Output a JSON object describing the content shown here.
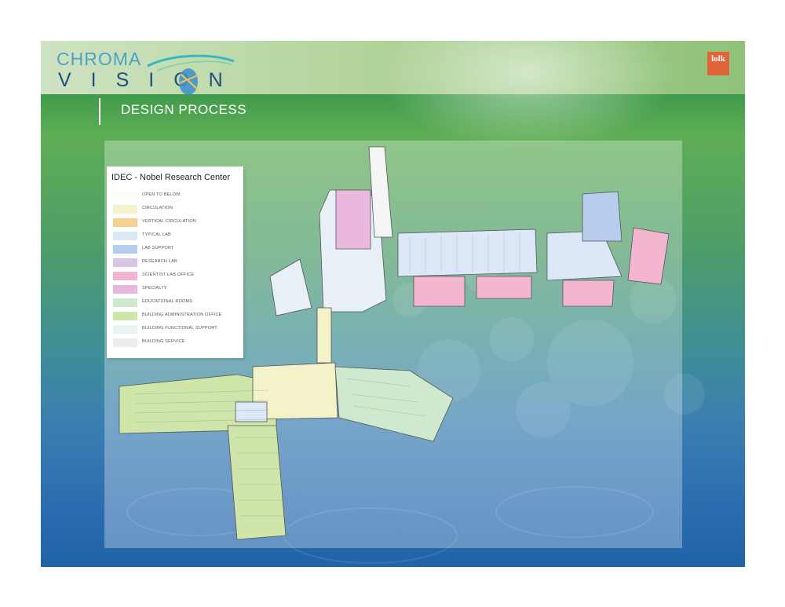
{
  "brand": {
    "name_line1": "CHROMA",
    "name_line2": "VISION",
    "badge_text": "lolk"
  },
  "section": {
    "title": "DESIGN PROCESS"
  },
  "legend": {
    "title": "IDEC - Nobel Research Center",
    "items": [
      {
        "label": "OPEN TO BELOW",
        "color": "#fdfdf5"
      },
      {
        "label": "CIRCULATION",
        "color": "#f4f2c8"
      },
      {
        "label": "VERTICAL CIRCULATION",
        "color": "#f7cf8f"
      },
      {
        "label": "TYPICAL LAB",
        "color": "#dce8f7"
      },
      {
        "label": "LAB SUPPORT",
        "color": "#b7cdee"
      },
      {
        "label": "RESEARCH LAB",
        "color": "#d8c5e6"
      },
      {
        "label": "SCIENTIST LAB OFFICE",
        "color": "#f3b5d0"
      },
      {
        "label": "SPECIALTY",
        "color": "#eab8de"
      },
      {
        "label": "EDUCATIONAL ROOMS",
        "color": "#cfe9cf"
      },
      {
        "label": "BUILDING ADMINISTRATION OFFICE",
        "color": "#cfe5a9"
      },
      {
        "label": "BUILDING FUNCTIONAL SUPPORT",
        "color": "#e7f4f3"
      },
      {
        "label": "BUILDING SERVICE",
        "color": "#ececec"
      }
    ]
  },
  "colors": {
    "accent_orange": "#e0633a",
    "vision_blue": "#1f4f82",
    "chroma_teal": "#4aa3c6"
  }
}
